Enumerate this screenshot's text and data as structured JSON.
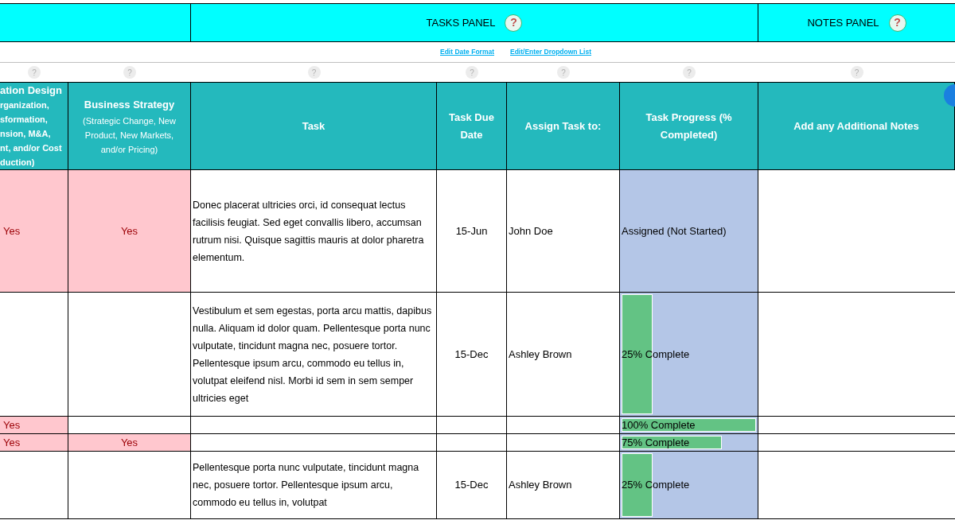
{
  "panels": [
    {
      "title": "TASKS PANEL",
      "help": "?"
    },
    {
      "title": "NOTES PANEL",
      "help": "?"
    }
  ],
  "links": [
    {
      "label": "Edit  Date Format"
    },
    {
      "label": "Edit/Enter Dropdown List"
    }
  ],
  "help_marks": [
    "?",
    "?",
    "?",
    "?",
    "?",
    "?",
    "?"
  ],
  "columns": [
    {
      "title": "ation Design",
      "subtitle_lines": [
        "rganization,",
        "sformation,",
        "nsion, M&A,",
        "nt, and/or Cost",
        "duction)"
      ]
    },
    {
      "title": "Business Strategy",
      "subtitle_lines": [
        "(Strategic Change, New",
        "Product, New Markets,",
        "and/or Pricing)"
      ]
    },
    {
      "title": "Task"
    },
    {
      "title": "Task Due Date"
    },
    {
      "title": "Assign Task to:"
    },
    {
      "title": "Task Progress (% Completed)"
    },
    {
      "title": "Add any Additional Notes"
    }
  ],
  "rows": [
    {
      "organization_design": {
        "text": "Yes",
        "flagged": true
      },
      "business_strategy": {
        "text": "Yes",
        "flagged": true
      },
      "task": "Donec placerat ultricies orci, id consequat lectus facilisis feugiat. Sed eget convallis libero, accumsan rutrum nisi. Quisque sagittis mauris at dolor pharetra elementum.",
      "due": "15-Jun",
      "assignee": "John Doe",
      "progress": {
        "label": "Assigned (Not Started)"
      }
    },
    {
      "organization_design": {
        "flagged": false
      },
      "business_strategy": {
        "flagged": false
      },
      "task": "Vestibulum et sem egestas, porta arcu mattis, dapibus nulla. Aliquam id dolor quam. Pellentesque porta nunc vulputate, tincidunt magna nec, posuere tortor. Pellentesque ipsum arcu, commodo eu tellus in, volutpat eleifend nisl. Morbi id sem in sem semper ultricies eget",
      "due": "15-Dec",
      "assignee": "Ashley Brown",
      "progress": {
        "label": "25% Complete",
        "level": 0.25
      }
    },
    {
      "organization_design": {
        "text": "Yes",
        "flagged": true
      },
      "business_strategy": {
        "flagged": false
      },
      "progress": {
        "label": "100% Complete",
        "level": 1
      }
    },
    {
      "organization_design": {
        "text": "Yes",
        "flagged": true
      },
      "business_strategy": {
        "text": "Yes",
        "flagged": true
      },
      "progress": {
        "label": "75% Complete",
        "level": 0.75
      }
    },
    {
      "organization_design": {
        "flagged": false
      },
      "business_strategy": {
        "flagged": false
      },
      "task": "Pellentesque porta nunc vulputate, tincidunt magna nec, posuere tortor. Pellentesque ipsum arcu, commodo eu tellus in, volutpat",
      "due": "15-Dec",
      "assignee": "Ashley Brown",
      "progress": {
        "label": "25% Complete",
        "level": 0.25
      }
    }
  ]
}
